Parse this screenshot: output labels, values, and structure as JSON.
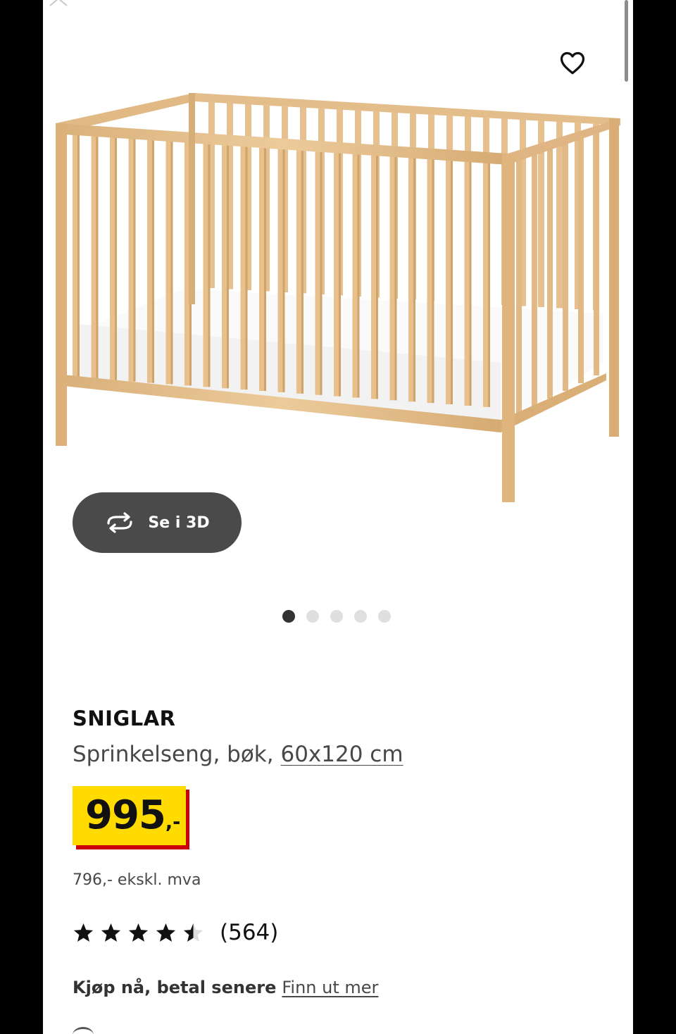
{
  "product": {
    "name": "SNIGLAR",
    "description": "Sprinkelseng, bøk, ",
    "size": "60x120 cm",
    "price_main": "995",
    "price_suffix": ",-",
    "price_excl_vat": "796,- ekskl. mva",
    "rating_value": 4.5,
    "rating_max": 5,
    "review_count": "(564)"
  },
  "view3d": {
    "label": "Se i 3D",
    "icon": "rotate-3d-icon"
  },
  "gallery": {
    "total_images": 5,
    "active_index": 0
  },
  "favorite": {
    "icon": "heart-icon"
  },
  "bnpl": {
    "text": "Kjøp nå, betal senere",
    "link": "Finn ut mer"
  },
  "colors": {
    "price_bg": "#ffdb00",
    "price_shadow": "#cc0008",
    "button_bg": "#4a4a4a",
    "wood": "#e8c594"
  }
}
